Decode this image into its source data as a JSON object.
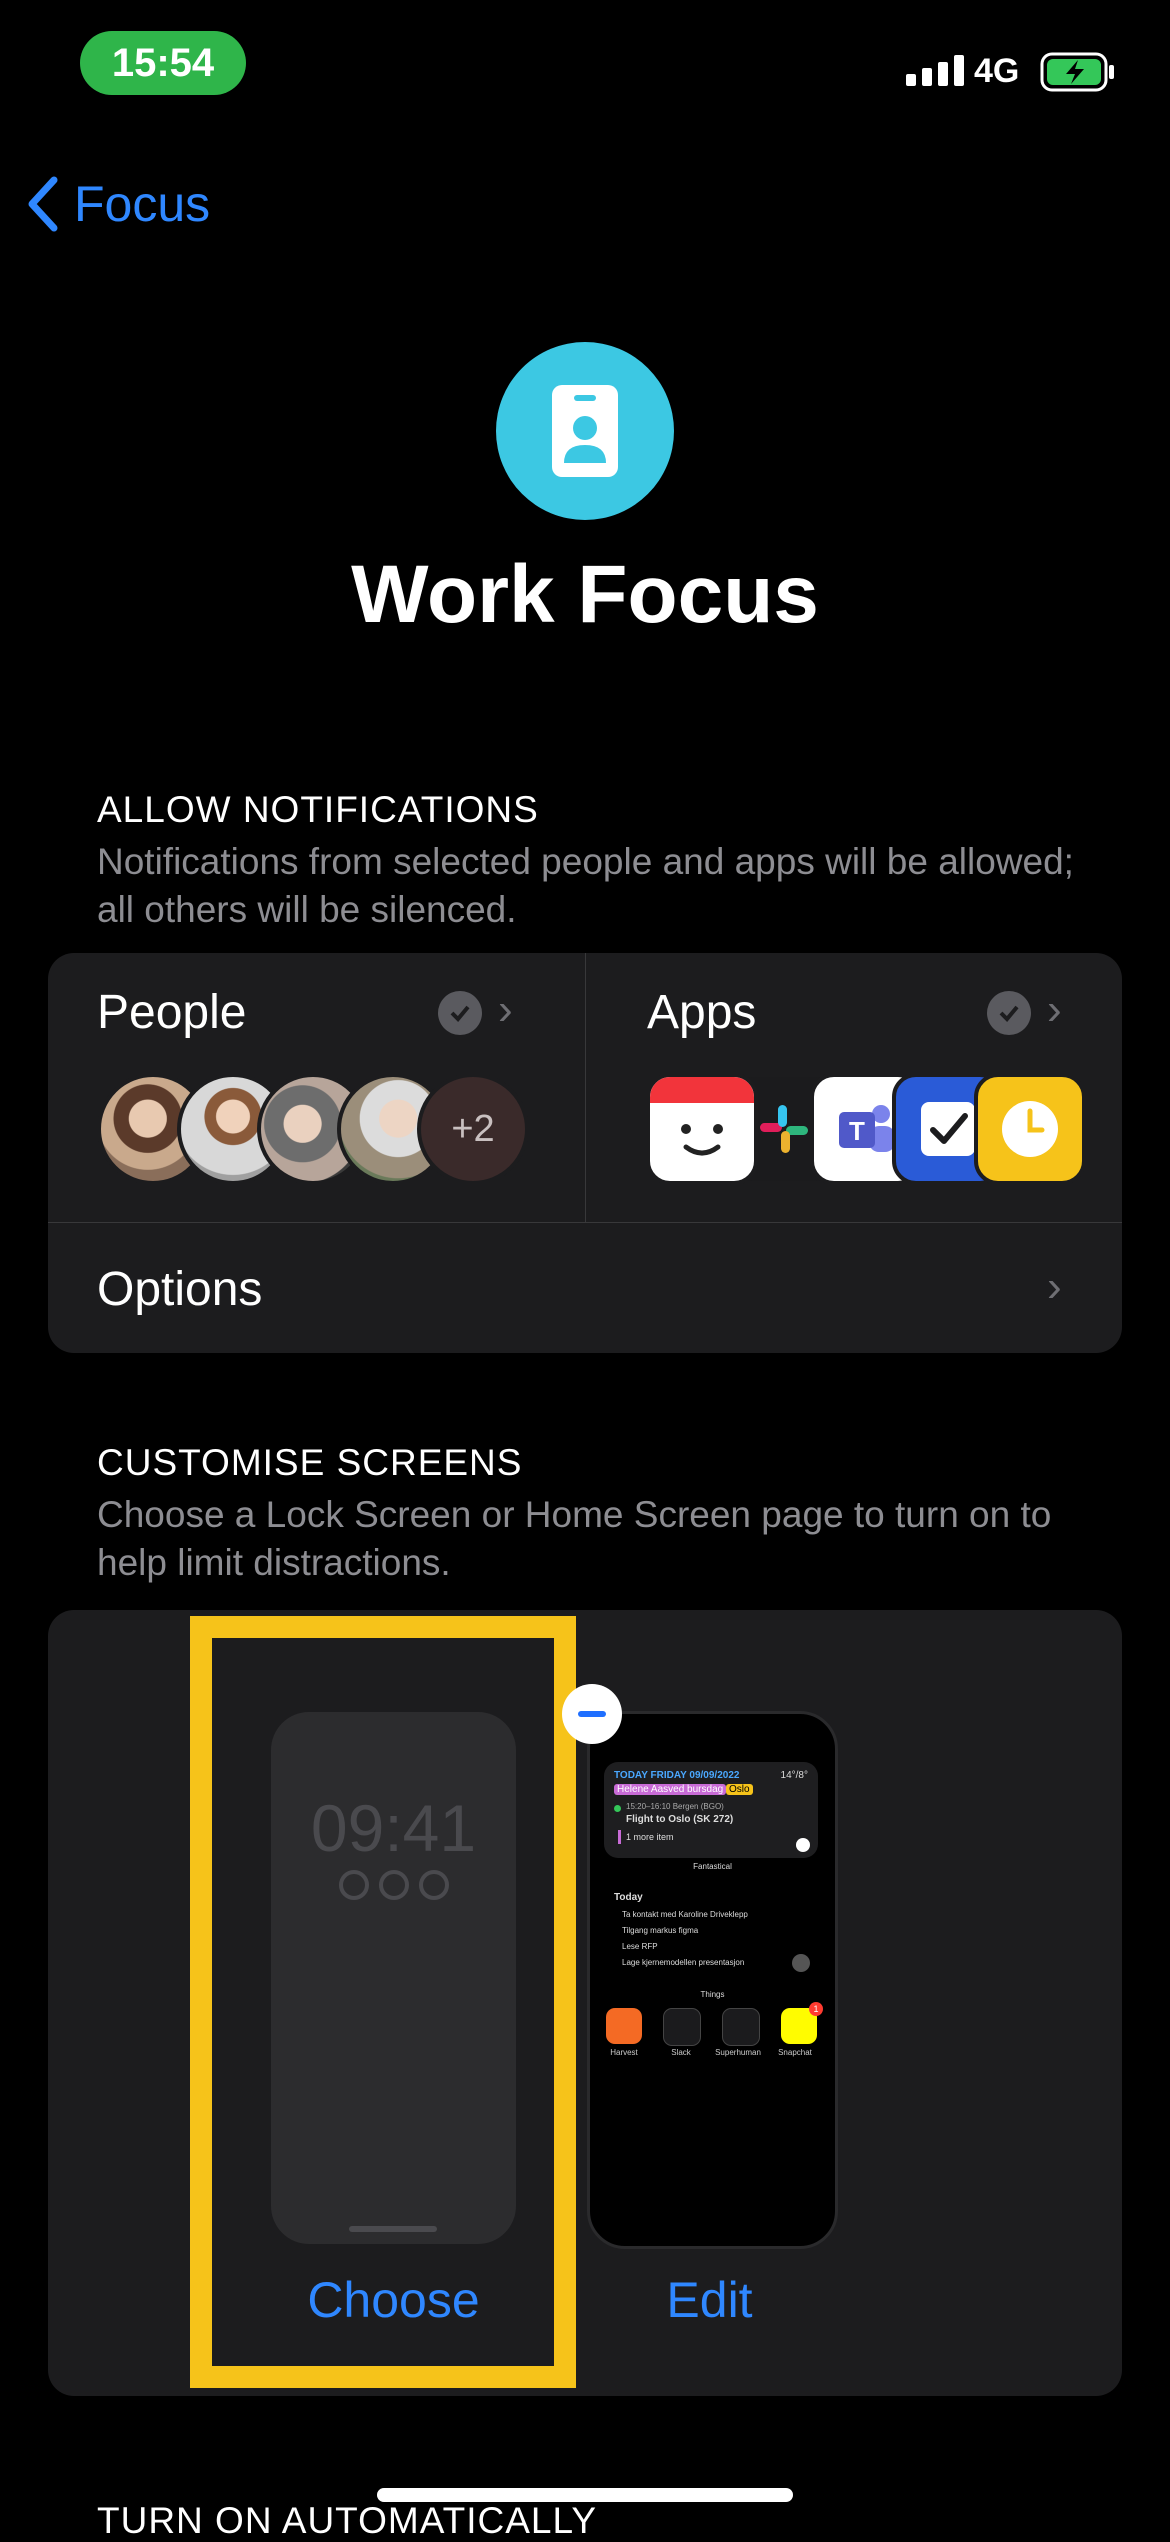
{
  "status_bar": {
    "time": "15:54",
    "network": "4G"
  },
  "nav": {
    "back_label": "Focus"
  },
  "header": {
    "title": "Work Focus",
    "icon": "id-badge-icon",
    "icon_color": "#3cc8e3"
  },
  "allow_notifications": {
    "heading": "ALLOW NOTIFICATIONS",
    "description": "Notifications from selected people and apps will be allowed; all others will be silenced.",
    "people": {
      "label": "People",
      "extra_count": "+2"
    },
    "apps": {
      "label": "Apps",
      "icons": [
        "fantastical-icon",
        "slack-icon",
        "teams-icon",
        "things-icon",
        "harvest-clock-icon"
      ]
    },
    "options_label": "Options"
  },
  "customise_screens": {
    "heading": "CUSTOMISE SCREENS",
    "description": "Choose a Lock Screen or Home Screen page to turn on to help limit distractions.",
    "lock_screen": {
      "time": "09:41",
      "button": "Choose"
    },
    "home_screen": {
      "button": "Edit",
      "widget_header": "TODAY FRIDAY 09/09/2022",
      "weather": "14°/8°",
      "event_birthday": "Helene Aasved bursdag",
      "event_tag": "Oslo",
      "flight_time": "15:20–16:10 Bergen (BGO)",
      "flight": "Flight to Oslo (SK 272)",
      "more": "1 more item",
      "widget1_name": "Fantastical",
      "things_title": "Today",
      "tasks": [
        "Ta kontakt med Karoline Driveklepp",
        "Tilgang markus figma",
        "Lese RFP",
        "Lage kjernemodellen presentasjon"
      ],
      "widget2_name": "Things",
      "apps": [
        "Harvest",
        "Slack",
        "Superhuman",
        "Snapchat"
      ],
      "badge": "1"
    }
  },
  "next_section": {
    "heading": "TURN ON AUTOMATICALLY"
  },
  "colors": {
    "accent": "#2f87ff",
    "highlight": "#f6c31a",
    "time_pill": "#2fb54a"
  }
}
